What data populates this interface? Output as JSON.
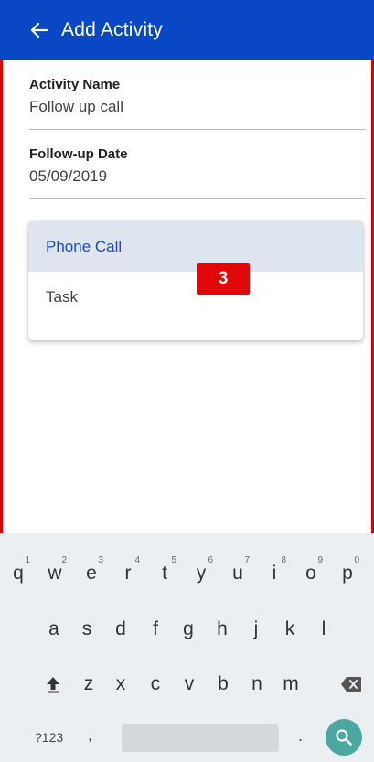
{
  "appbar": {
    "title": "Add Activity",
    "back_icon": "arrow-left-icon",
    "color": "#0a47c4"
  },
  "fields": [
    {
      "label": "Activity Name",
      "value": "Follow up call"
    },
    {
      "label": "Follow-up Date",
      "value": "05/09/2019"
    }
  ],
  "dropdown": {
    "options": [
      "Phone Call",
      "Task"
    ],
    "selected": "Phone Call"
  },
  "badge": {
    "text": "3",
    "color": "#e0070b"
  },
  "keyboard": {
    "row1": [
      "q",
      "w",
      "e",
      "r",
      "t",
      "y",
      "u",
      "i",
      "o",
      "p"
    ],
    "row1_hints": [
      "1",
      "2",
      "3",
      "4",
      "5",
      "6",
      "7",
      "8",
      "9",
      "0"
    ],
    "row2": [
      "a",
      "s",
      "d",
      "f",
      "g",
      "h",
      "j",
      "k",
      "l"
    ],
    "row3": [
      "z",
      "x",
      "c",
      "v",
      "b",
      "n",
      "m"
    ],
    "symbols_key": "?123",
    "comma_key": ",",
    "period_key": ".",
    "shift_icon": "shift-icon",
    "backspace_icon": "backspace-icon",
    "search_icon": "search-icon",
    "search_color": "#4aa8a0"
  }
}
